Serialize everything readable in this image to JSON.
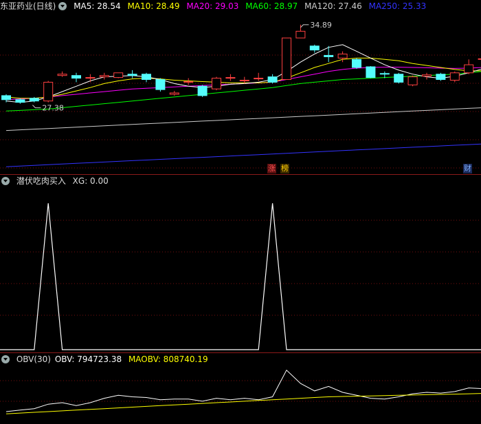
{
  "main_header": {
    "title": "东亚药业(日线)",
    "ma5": "MA5: 28.54",
    "ma10": "MA10: 28.49",
    "ma20": "MA20: 29.03",
    "ma60": "MA60: 28.97",
    "ma120": "MA120: 27.46",
    "ma250": "MA250: 25.33"
  },
  "annotations": {
    "high": "34.89",
    "low": "27.38"
  },
  "badges": {
    "zhang": "涨",
    "bang": "榜",
    "cai": "财"
  },
  "indicator_header": {
    "name": "潜伏吃肉买入",
    "xg": "XG: 0.00"
  },
  "obv_header": {
    "name": "OBV(30)",
    "obv": "OBV: 794723.38",
    "maobv": "MAOBV: 808740.19"
  },
  "colors": {
    "ma5": "#ffffff",
    "ma10": "#ffff00",
    "ma20": "#ff00ff",
    "ma60": "#00ff00",
    "ma120": "#cccccc",
    "ma250": "#3333ff",
    "up": "#ff4040",
    "down": "#54fcfc",
    "grid": "#7a1010",
    "sep": "#8b1a1a"
  },
  "chart_data": [
    {
      "type": "candlestick",
      "title": "东亚药业(日线)",
      "candles": [
        {
          "o": 29.6,
          "c": 29.3,
          "h": 29.7,
          "l": 29.1
        },
        {
          "o": 29.3,
          "c": 29.1,
          "h": 29.4,
          "l": 29.0
        },
        {
          "o": 29.4,
          "c": 29.2,
          "h": 29.5,
          "l": 29.1
        },
        {
          "o": 29.2,
          "c": 30.6,
          "h": 30.7,
          "l": 29.1
        },
        {
          "o": 31.1,
          "c": 31.2,
          "h": 31.4,
          "l": 31.0
        },
        {
          "o": 31.1,
          "c": 30.9,
          "h": 31.3,
          "l": 30.6
        },
        {
          "o": 30.9,
          "c": 30.95,
          "h": 31.2,
          "l": 30.6
        },
        {
          "o": 31.0,
          "c": 31.1,
          "h": 31.3,
          "l": 30.8
        },
        {
          "o": 30.95,
          "c": 31.3,
          "h": 31.3,
          "l": 30.9
        },
        {
          "o": 31.2,
          "c": 31.1,
          "h": 31.5,
          "l": 30.9
        },
        {
          "o": 31.2,
          "c": 30.8,
          "h": 31.3,
          "l": 30.6
        },
        {
          "o": 30.8,
          "c": 30.05,
          "h": 30.9,
          "l": 29.9
        },
        {
          "o": 29.7,
          "c": 29.8,
          "h": 29.95,
          "l": 29.6
        },
        {
          "o": 30.6,
          "c": 30.65,
          "h": 30.9,
          "l": 30.4
        },
        {
          "o": 30.3,
          "c": 29.6,
          "h": 30.4,
          "l": 29.5
        },
        {
          "o": 30.1,
          "c": 30.9,
          "h": 31.0,
          "l": 30.0
        },
        {
          "o": 30.9,
          "c": 30.95,
          "h": 31.2,
          "l": 30.7
        },
        {
          "o": 30.7,
          "c": 30.75,
          "h": 31.0,
          "l": 30.5
        },
        {
          "o": 30.85,
          "c": 30.9,
          "h": 31.3,
          "l": 30.7
        },
        {
          "o": 31.0,
          "c": 30.6,
          "h": 31.2,
          "l": 30.5
        },
        {
          "o": 30.8,
          "c": 33.9,
          "h": 33.9,
          "l": 30.8
        },
        {
          "o": 33.9,
          "c": 34.4,
          "h": 34.89,
          "l": 33.9
        },
        {
          "o": 33.3,
          "c": 33.0,
          "h": 33.4,
          "l": 32.8
        },
        {
          "o": 32.6,
          "c": 32.5,
          "h": 33.3,
          "l": 32.1
        },
        {
          "o": 32.4,
          "c": 32.7,
          "h": 32.9,
          "l": 32.1
        },
        {
          "o": 32.3,
          "c": 31.7,
          "h": 32.4,
          "l": 31.6
        },
        {
          "o": 31.75,
          "c": 30.95,
          "h": 31.8,
          "l": 30.9
        },
        {
          "o": 31.25,
          "c": 31.2,
          "h": 31.4,
          "l": 30.9
        },
        {
          "o": 31.2,
          "c": 30.6,
          "h": 31.3,
          "l": 30.5
        },
        {
          "o": 30.4,
          "c": 31.0,
          "h": 31.1,
          "l": 30.3
        },
        {
          "o": 31.05,
          "c": 31.15,
          "h": 31.3,
          "l": 30.8
        },
        {
          "o": 31.2,
          "c": 30.8,
          "h": 31.3,
          "l": 30.7
        },
        {
          "o": 30.75,
          "c": 31.3,
          "h": 31.4,
          "l": 30.6
        },
        {
          "o": 31.3,
          "c": 31.9,
          "h": 32.3,
          "l": 31.2
        },
        {
          "o": 32.3,
          "c": 32.35,
          "h": 32.5,
          "l": 32.1
        },
        {
          "o": 32.1,
          "c": 32.15,
          "h": 32.5,
          "l": 31.9
        }
      ],
      "ma5": [
        29.2,
        29.1,
        29.2,
        29.5,
        29.9,
        30.3,
        30.7,
        31.0,
        31.05,
        31.1,
        31.0,
        30.8,
        30.5,
        30.3,
        30.2,
        30.3,
        30.45,
        30.5,
        30.6,
        30.8,
        31.4,
        32.1,
        32.7,
        33.2,
        33.4,
        32.9,
        32.4,
        31.9,
        31.5,
        31.2,
        31.0,
        30.9,
        31.05,
        31.3,
        31.6,
        31.9
      ],
      "ma10": [
        29.5,
        29.4,
        29.4,
        29.5,
        29.7,
        29.95,
        30.2,
        30.5,
        30.7,
        30.85,
        30.9,
        30.85,
        30.75,
        30.7,
        30.65,
        30.6,
        30.55,
        30.55,
        30.55,
        30.6,
        30.9,
        31.3,
        31.7,
        32.0,
        32.3,
        32.4,
        32.4,
        32.3,
        32.2,
        32.0,
        31.85,
        31.7,
        31.55,
        31.45,
        31.45,
        31.55
      ],
      "ma20": [
        29.3,
        29.35,
        29.4,
        29.5,
        29.6,
        29.7,
        29.8,
        29.9,
        30.0,
        30.1,
        30.15,
        30.2,
        30.25,
        30.3,
        30.35,
        30.4,
        30.45,
        30.5,
        30.55,
        30.6,
        30.8,
        31.0,
        31.2,
        31.4,
        31.55,
        31.65,
        31.7,
        31.72,
        31.72,
        31.7,
        31.68,
        31.65,
        31.63,
        31.65,
        31.7,
        31.8
      ],
      "ma60": [
        28.45,
        28.5,
        28.55,
        28.6,
        28.7,
        28.8,
        28.9,
        29.0,
        29.1,
        29.2,
        29.3,
        29.4,
        29.5,
        29.6,
        29.7,
        29.8,
        29.9,
        30.0,
        30.1,
        30.2,
        30.35,
        30.5,
        30.6,
        30.7,
        30.8,
        30.85,
        30.9,
        30.95,
        31.0,
        31.05,
        31.1,
        31.15,
        31.2,
        31.3,
        31.4,
        31.5
      ],
      "ma120": [
        27.0,
        27.05,
        27.1,
        27.15,
        27.2,
        27.25,
        27.3,
        27.35,
        27.4,
        27.45,
        27.5,
        27.55,
        27.6,
        27.65,
        27.7,
        27.75,
        27.8,
        27.85,
        27.9,
        27.95,
        28.0,
        28.05,
        28.1,
        28.15,
        28.2,
        28.25,
        28.3,
        28.35,
        28.4,
        28.45,
        28.5,
        28.55,
        28.6,
        28.65,
        28.7,
        28.75
      ],
      "ma250": [
        24.3,
        24.35,
        24.4,
        24.45,
        24.5,
        24.55,
        24.6,
        24.65,
        24.7,
        24.75,
        24.8,
        24.85,
        24.9,
        24.95,
        25.0,
        25.05,
        25.1,
        25.15,
        25.2,
        25.25,
        25.3,
        25.35,
        25.4,
        25.45,
        25.5,
        25.55,
        25.6,
        25.65,
        25.7,
        25.75,
        25.8,
        25.85,
        25.9,
        25.95,
        26.0,
        26.05
      ],
      "ylim": [
        23.9,
        35.6
      ]
    },
    {
      "type": "line",
      "title": "潜伏吃肉买入",
      "series": [
        {
          "name": "XG",
          "values": [
            0,
            0,
            0,
            1,
            0,
            0,
            0,
            0,
            0,
            0,
            0,
            0,
            0,
            0,
            0,
            0,
            0,
            0,
            0,
            1,
            0,
            0,
            0,
            0,
            0,
            0,
            0,
            0,
            0,
            0,
            0,
            0,
            0,
            0,
            0,
            0
          ]
        }
      ],
      "ylim": [
        0,
        1.1
      ]
    },
    {
      "type": "line",
      "title": "OBV(30)",
      "series": [
        {
          "name": "OBV",
          "values": [
            0.7,
            0.8,
            0.9,
            1.2,
            1.3,
            1.1,
            1.3,
            1.6,
            1.8,
            1.7,
            1.65,
            1.5,
            1.55,
            1.55,
            1.4,
            1.6,
            1.5,
            1.6,
            1.5,
            1.7,
            3.5,
            2.6,
            2.1,
            2.4,
            2.0,
            1.8,
            1.6,
            1.55,
            1.7,
            1.9,
            2.0,
            1.95,
            2.05,
            2.3,
            2.25,
            2.35
          ]
        },
        {
          "name": "MAOBV",
          "values": [
            0.55,
            0.6,
            0.65,
            0.7,
            0.75,
            0.8,
            0.85,
            0.9,
            0.95,
            1.0,
            1.05,
            1.1,
            1.15,
            1.2,
            1.25,
            1.3,
            1.35,
            1.4,
            1.45,
            1.5,
            1.55,
            1.6,
            1.65,
            1.7,
            1.72,
            1.74,
            1.76,
            1.78,
            1.8,
            1.82,
            1.84,
            1.86,
            1.88,
            1.9,
            1.93,
            1.96
          ]
        }
      ],
      "ylim": [
        0,
        4.0
      ]
    }
  ]
}
